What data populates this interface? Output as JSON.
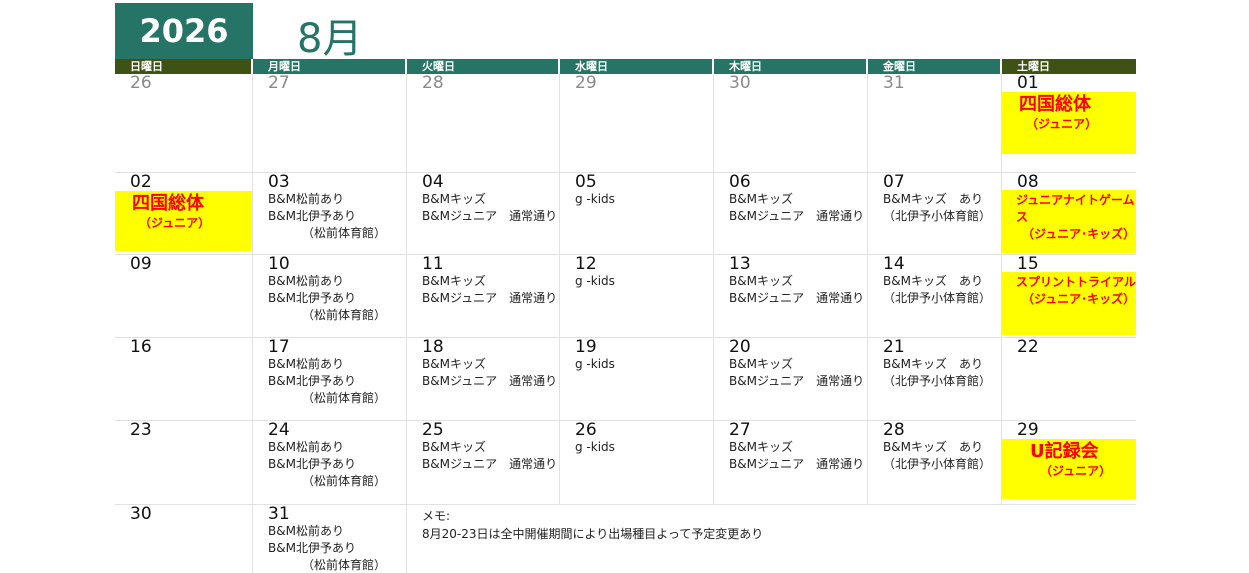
{
  "header": {
    "year": "2026",
    "month": "8月"
  },
  "weekdays": [
    "日曜日",
    "月曜日",
    "火曜日",
    "水曜日",
    "木曜日",
    "金曜日",
    "土曜日"
  ],
  "weeks": [
    [
      {
        "day": "26",
        "muted": true
      },
      {
        "day": "27",
        "muted": true
      },
      {
        "day": "28",
        "muted": true
      },
      {
        "day": "29",
        "muted": true
      },
      {
        "day": "30",
        "muted": true
      },
      {
        "day": "31",
        "muted": true
      },
      {
        "day": "01",
        "highlight": {
          "title": "四国総体",
          "sub": "（ジュニア）"
        }
      }
    ],
    [
      {
        "day": "02",
        "highlight": {
          "title": "四国総体",
          "sub": "（ジュニア）"
        }
      },
      {
        "day": "03",
        "events": [
          "B&M松前あり",
          "B&M北伊予あり",
          "（松前体育館）"
        ]
      },
      {
        "day": "04",
        "events": [
          "B&Mキッズ",
          "B&Mジュニア　通常通り"
        ]
      },
      {
        "day": "05",
        "events": [
          "g -kids"
        ]
      },
      {
        "day": "06",
        "events": [
          "B&Mキッズ",
          "B&Mジュニア　通常通り"
        ]
      },
      {
        "day": "07",
        "events": [
          "B&Mキッズ　あり",
          "（北伊予小体育館）"
        ]
      },
      {
        "day": "08",
        "highlight": {
          "lines": [
            "ジュニアナイトゲームス",
            "（ジュニア･キッズ）"
          ]
        }
      }
    ],
    [
      {
        "day": "09"
      },
      {
        "day": "10",
        "events": [
          "B&M松前あり",
          "B&M北伊予あり",
          "（松前体育館）"
        ]
      },
      {
        "day": "11",
        "events": [
          "B&Mキッズ",
          "B&Mジュニア　通常通り"
        ]
      },
      {
        "day": "12",
        "events": [
          "g -kids"
        ]
      },
      {
        "day": "13",
        "events": [
          "B&Mキッズ",
          "B&Mジュニア　通常通り"
        ]
      },
      {
        "day": "14",
        "events": [
          "B&Mキッズ　あり",
          "（北伊予小体育館）"
        ]
      },
      {
        "day": "15",
        "highlight": {
          "lines": [
            "スプリントトライアル",
            "（ジュニア･キッズ）"
          ]
        }
      }
    ],
    [
      {
        "day": "16"
      },
      {
        "day": "17",
        "events": [
          "B&M松前あり",
          "B&M北伊予あり",
          "（松前体育館）"
        ]
      },
      {
        "day": "18",
        "events": [
          "B&Mキッズ",
          "B&Mジュニア　通常通り"
        ]
      },
      {
        "day": "19",
        "events": [
          "g -kids"
        ]
      },
      {
        "day": "20",
        "events": [
          "B&Mキッズ",
          "B&Mジュニア　通常通り"
        ]
      },
      {
        "day": "21",
        "events": [
          "B&Mキッズ　あり",
          "（北伊予小体育館）"
        ]
      },
      {
        "day": "22"
      }
    ],
    [
      {
        "day": "23"
      },
      {
        "day": "24",
        "events": [
          "B&M松前あり",
          "B&M北伊予あり",
          "（松前体育館）"
        ]
      },
      {
        "day": "25",
        "events": [
          "B&Mキッズ",
          "B&Mジュニア　通常通り"
        ]
      },
      {
        "day": "26",
        "events": [
          "g -kids"
        ]
      },
      {
        "day": "27",
        "events": [
          "B&Mキッズ",
          "B&Mジュニア　通常通り"
        ]
      },
      {
        "day": "28",
        "events": [
          "B&Mキッズ　あり",
          "（北伊予小体育館）"
        ]
      },
      {
        "day": "29",
        "highlight": {
          "title": "U記録会",
          "sub": "（ジュニア）"
        }
      }
    ],
    [
      {
        "day": "30"
      },
      {
        "day": "31",
        "events": [
          "B&M松前あり",
          "B&M北伊予あり",
          "（松前体育館）"
        ]
      }
    ]
  ],
  "memo": {
    "label": "メモ:",
    "text": "8月20-23日は全中開催期間により出場種目よって予定変更あり"
  },
  "colors": {
    "teal": "#267465",
    "olive": "#3f5215",
    "highlight": "#ffff00",
    "accent": "#ff0000"
  }
}
